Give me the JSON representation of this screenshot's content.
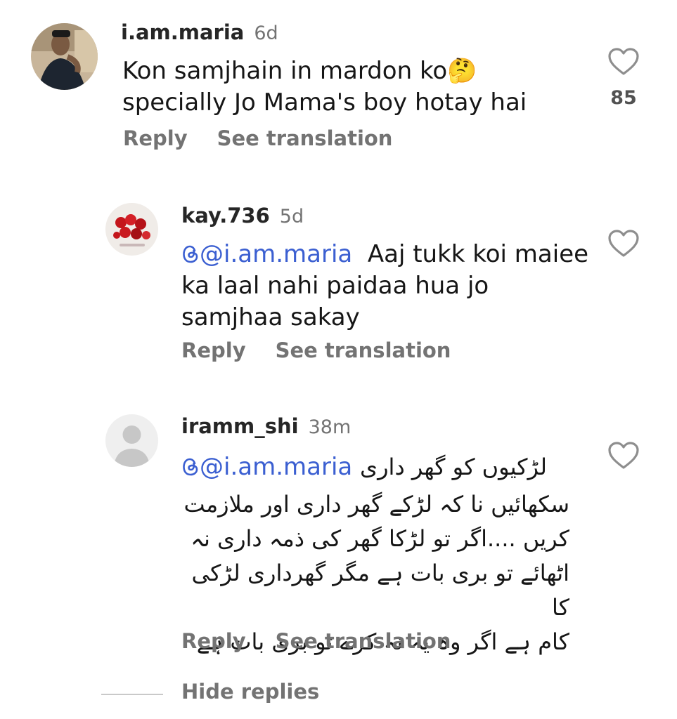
{
  "comments": [
    {
      "username": "i.am.maria",
      "time": "6d",
      "text_lines": [
        "Kon samjhain in mardon ko🤔",
        "specially Jo Mama's boy  hotay hai"
      ],
      "reply_label": "Reply",
      "translate_label": "See translation",
      "likes": "85"
    },
    {
      "username": "kay.736",
      "time": "5d",
      "mention": "@i.am.maria",
      "text_first": "  Aaj tukk koi maiee",
      "text_lines": [
        "ka laal nahi paidaa hua jo",
        "samjhaa sakay"
      ],
      "reply_label": "Reply",
      "translate_label": "See translation"
    },
    {
      "username": "iramm_shi",
      "time": "38m",
      "mention": "@i.am.maria",
      "text_first": "لڑکیوں کو گھر داری",
      "text_lines": [
        "سکھائیں نا کہ لڑکے گھر داری اور ملازمت",
        "کریں ....اگر تو لڑکا گھر کی ذمہ داری نہ",
        "اٹھائے تو بری بات ہے مگر گھرداری لڑکی کا",
        "کام ہے اگر وہ یہ نہ کرے تو بری بات ہے"
      ],
      "reply_label": "Reply",
      "translate_label": "See translation"
    }
  ],
  "hide_replies_label": "Hide replies",
  "colors": {
    "mention": "#3b5fd1",
    "secondary_text": "#737373",
    "background": "#ffffff"
  },
  "icons": {
    "like": "heart-outline-icon",
    "thread": "threads-icon"
  }
}
